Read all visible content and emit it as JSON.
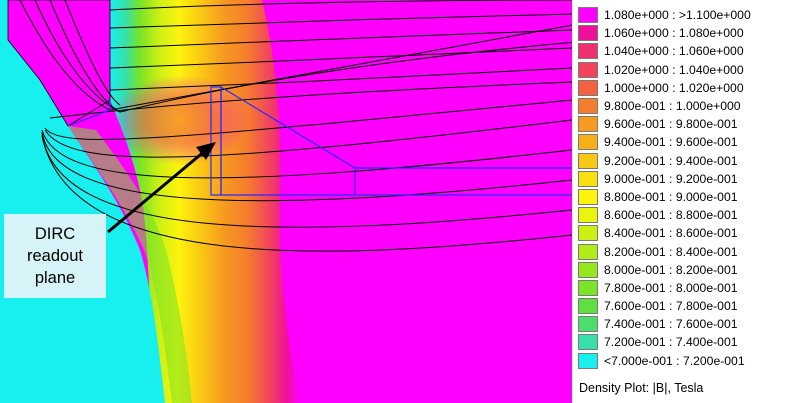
{
  "callout": {
    "lines": [
      "DIRC",
      "readout",
      "plane"
    ]
  },
  "legend": {
    "title": "Density Plot: |B|, Tesla",
    "items": [
      {
        "label": "1.080e+000 : >1.100e+000",
        "color": "#ff00ff"
      },
      {
        "label": "1.060e+000 : 1.080e+000",
        "color": "#f0109a"
      },
      {
        "label": "1.040e+000 : 1.060e+000",
        "color": "#f0306e"
      },
      {
        "label": "1.020e+000 : 1.040e+000",
        "color": "#f2445e"
      },
      {
        "label": "1.000e+000 : 1.020e+000",
        "color": "#f46040"
      },
      {
        "label": "9.800e-001 : 1.000e+000",
        "color": "#f57e2c"
      },
      {
        "label": "9.600e-001 : 9.800e-001",
        "color": "#f79a20"
      },
      {
        "label": "9.400e-001 : 9.600e-001",
        "color": "#f8b018"
      },
      {
        "label": "9.200e-001 : 9.400e-001",
        "color": "#fac814"
      },
      {
        "label": "9.000e-001 : 9.200e-001",
        "color": "#fbe010"
      },
      {
        "label": "8.800e-001 : 9.000e-001",
        "color": "#fcf40c"
      },
      {
        "label": "8.600e-001 : 8.800e-001",
        "color": "#eaf40c"
      },
      {
        "label": "8.400e-001 : 8.600e-001",
        "color": "#cdf014"
      },
      {
        "label": "8.200e-001 : 8.400e-001",
        "color": "#b2ec18"
      },
      {
        "label": "8.000e-001 : 8.200e-001",
        "color": "#96e81c"
      },
      {
        "label": "7.800e-001 : 8.000e-001",
        "color": "#7ae426"
      },
      {
        "label": "7.600e-001 : 7.800e-001",
        "color": "#60e03e"
      },
      {
        "label": "7.400e-001 : 7.600e-001",
        "color": "#4ade6e"
      },
      {
        "label": "7.200e-001 : 7.400e-001",
        "color": "#36e0a8"
      },
      {
        "label": "<7.000e-001 : 7.200e-001",
        "color": "#18f0f0"
      }
    ]
  }
}
